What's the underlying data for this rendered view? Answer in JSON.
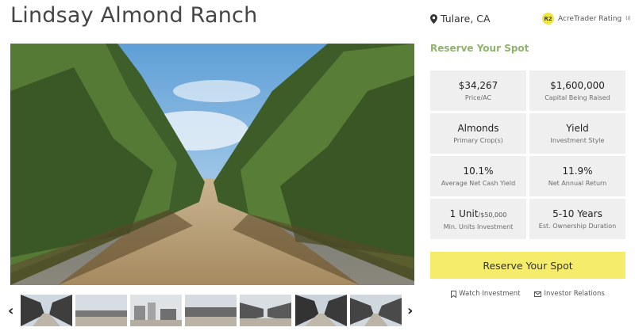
{
  "header": {
    "title": "Lindsay Almond Ranch",
    "location": "Tulare, CA",
    "rating_badge": "R2",
    "rating_label": "AcreTrader Rating",
    "rating_sup": "(i)"
  },
  "reserve_link": "Reserve Your Spot",
  "stats": [
    {
      "value": "$34,267",
      "label": "Price/AC"
    },
    {
      "value": "$1,600,000",
      "label": "Capital Being Raised"
    },
    {
      "value": "Almonds",
      "label": "Primary Crop(s)"
    },
    {
      "value": "Yield",
      "label": "Investment Style"
    },
    {
      "value": "10.1%",
      "label": "Average Net Cash Yield"
    },
    {
      "value": "11.9%",
      "label": "Net Annual Return"
    },
    {
      "value": "1 Unit",
      "value_small": "/$50,000",
      "label": "Min. Units Investment"
    },
    {
      "value": "5-10 Years",
      "label": "Est. Ownership Duration"
    }
  ],
  "cta_label": "Reserve Your Spot",
  "actions": {
    "watch": "Watch Investment",
    "investor": "Investor Relations"
  },
  "colors": {
    "accent_yellow": "#f6ec6b",
    "reserve_green": "#8fb36a",
    "stat_bg": "#efefef"
  },
  "icons": [
    "map-pin-icon",
    "bookmark-icon",
    "mail-icon",
    "chevron-left-icon",
    "chevron-right-icon"
  ]
}
